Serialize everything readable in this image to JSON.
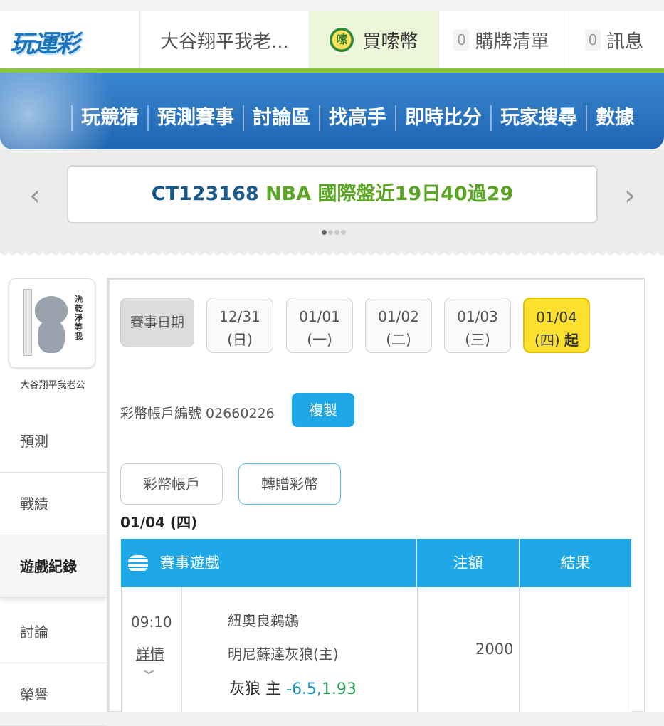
{
  "header": {
    "logo_text": "玩運彩",
    "username": "大谷翔平我老...",
    "buy_coins": "買嗦幣",
    "coin_icon_text": "嗦",
    "cart_count": "0",
    "cart_label": "購牌清單",
    "msg_count": "0",
    "msg_label": "訊息"
  },
  "nav": {
    "items": [
      "玩競猜",
      "預測賽事",
      "討論區",
      "找高手",
      "即時比分",
      "玩家搜尋",
      "數據"
    ]
  },
  "banner": {
    "id": "CT123168",
    "text": "NBA 國際盤近19日40過29",
    "prev_arrow": "‹",
    "next_arrow": "›"
  },
  "sidebar": {
    "avatar_caption": "洗乾淨等我",
    "username": "大谷翔平我老公",
    "items": [
      "預測",
      "戰績",
      "遊戲紀錄",
      "討論",
      "榮譽"
    ]
  },
  "dates": {
    "label": "賽事日期",
    "days": [
      {
        "date": "12/31",
        "weekday": "(日)"
      },
      {
        "date": "01/01",
        "weekday": "(一)"
      },
      {
        "date": "01/02",
        "weekday": "(二)"
      },
      {
        "date": "01/03",
        "weekday": "(三)"
      },
      {
        "date": "01/04",
        "weekday": "(四)",
        "suffix": "起"
      }
    ]
  },
  "account": {
    "label": "彩幣帳戶編號 02660226",
    "copy_button": "複製",
    "tab_account": "彩幣帳戶",
    "tab_transfer": "轉贈彩幣"
  },
  "records": {
    "date_heading": "01/04 (四)",
    "columns": [
      "賽事遊戲",
      "注額",
      "結果"
    ],
    "rows": [
      {
        "time": "09:10",
        "detail": "詳情",
        "away": "紐奧良鵜鶘",
        "home": "明尼蘇達灰狼(主)",
        "pick_team": "灰狼 主",
        "pick_line": "-6.5,",
        "pick_odds": "1.93",
        "stake": "2000",
        "result": ""
      }
    ]
  }
}
